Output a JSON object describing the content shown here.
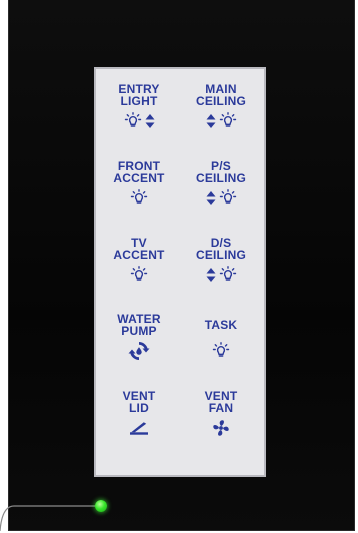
{
  "panel": {
    "keys": [
      {
        "label": "ENTRY\nLIGHT",
        "icons": [
          "bulb-icon",
          "dimmer-arrows-icon"
        ]
      },
      {
        "label": "MAIN\nCEILING",
        "icons": [
          "dimmer-arrows-icon",
          "bulb-icon"
        ]
      },
      {
        "label": "FRONT\nACCENT",
        "icons": [
          "bulb-icon"
        ]
      },
      {
        "label": "P/S\nCEILING",
        "icons": [
          "dimmer-arrows-icon",
          "bulb-icon"
        ]
      },
      {
        "label": "TV\nACCENT",
        "icons": [
          "bulb-icon"
        ]
      },
      {
        "label": "D/S\nCEILING",
        "icons": [
          "dimmer-arrows-icon",
          "bulb-icon"
        ]
      },
      {
        "label": "WATER\nPUMP",
        "icons": [
          "water-pump-icon"
        ]
      },
      {
        "label": "TASK",
        "icons": [
          "bulb-icon"
        ]
      },
      {
        "label": "VENT\nLID",
        "icons": [
          "vent-lid-icon"
        ]
      },
      {
        "label": "VENT\nFAN",
        "icons": [
          "fan-icon"
        ]
      }
    ]
  },
  "colors": {
    "label": "#2b3a9a",
    "panel": "#e7e7ea",
    "bezel": "#080808",
    "led": "#38e62b"
  }
}
